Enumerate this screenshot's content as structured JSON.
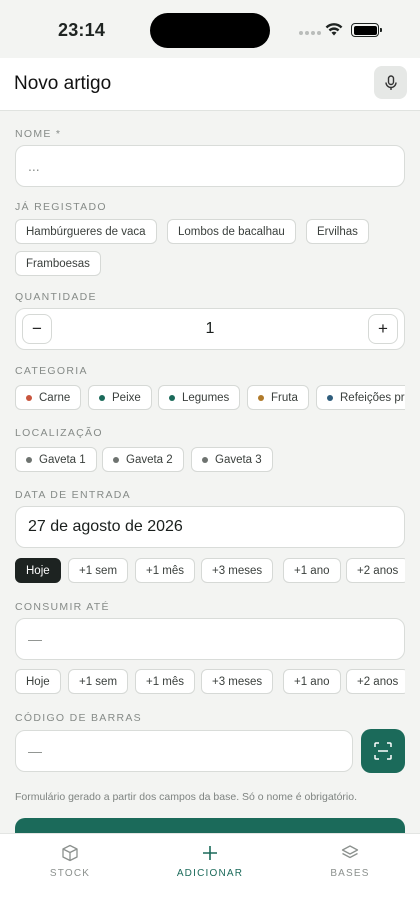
{
  "status_bar": {
    "time": "23:14"
  },
  "header": {
    "title": "Novo artigo",
    "mic_icon": "microphone-icon"
  },
  "form": {
    "name": {
      "label": "NOME *",
      "placeholder": "..."
    },
    "registered": {
      "label": "JÁ REGISTADO",
      "items": [
        "Hambúrgueres de vaca",
        "Lombos de bacalhau",
        "Ervilhas",
        "Framboesas"
      ]
    },
    "quantity": {
      "label": "QUANTIDADE",
      "value": "1",
      "minus": "−",
      "plus": "+"
    },
    "category": {
      "label": "CATEGORIA",
      "items": [
        {
          "label": "Carne",
          "color": "#c8553d"
        },
        {
          "label": "Peixe",
          "color": "#1b6a5a"
        },
        {
          "label": "Legumes",
          "color": "#1b6a5a"
        },
        {
          "label": "Fruta",
          "color": "#b07a2a"
        },
        {
          "label": "Refeições prontas",
          "color": "#2f5d7c"
        }
      ]
    },
    "location": {
      "label": "LOCALIZAÇÃO",
      "items": [
        {
          "label": "Gaveta 1",
          "color": "#6e7370"
        },
        {
          "label": "Gaveta 2",
          "color": "#6e7370"
        },
        {
          "label": "Gaveta 3",
          "color": "#6e7370"
        }
      ]
    },
    "entry_date": {
      "label": "DATA DE ENTRADA",
      "value": "27 de agosto de 2026",
      "shortcuts": [
        "Hoje",
        "+1 sem",
        "+1 mês",
        "+3 meses",
        "+1 ano",
        "+2 anos"
      ],
      "active_shortcut": "Hoje"
    },
    "consume_by": {
      "label": "CONSUMIR ATÉ",
      "value": "—",
      "shortcuts": [
        "Hoje",
        "+1 sem",
        "+1 mês",
        "+3 meses",
        "+1 ano",
        "+2 anos"
      ]
    },
    "barcode": {
      "label": "CÓDIGO DE BARRAS",
      "value": "—",
      "scan_icon": "barcode-scan-icon"
    },
    "note": "Formulário gerado a partir dos campos da base. Só o nome é obrigatório."
  },
  "tabbar": {
    "tabs": [
      {
        "label": "STOCK",
        "icon": "box-icon"
      },
      {
        "label": "ADICIONAR",
        "icon": "plus-icon"
      },
      {
        "label": "BASES",
        "icon": "layers-icon"
      }
    ],
    "active": "ADICIONAR",
    "accent": "#1b6a5a"
  }
}
